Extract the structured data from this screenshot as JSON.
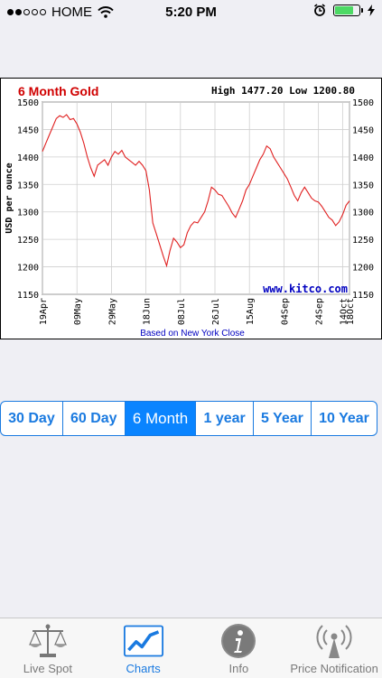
{
  "statusbar": {
    "carrier": "HOME",
    "time": "5:20 PM"
  },
  "chart_data": {
    "type": "line",
    "title": "6 Month Gold",
    "high_label": "High 1477.20 Low 1200.80",
    "ylabel": "USD per ounce",
    "xlabel": "Based on New York Close",
    "watermark": "www.kitco.com",
    "ylim": [
      1150,
      1500
    ],
    "yticks": [
      1150,
      1200,
      1250,
      1300,
      1350,
      1400,
      1450,
      1500
    ],
    "xticks": [
      "19Apr",
      "09May",
      "29May",
      "18Jun",
      "08Jul",
      "26Jul",
      "15Aug",
      "04Sep",
      "24Sep",
      "14Oct",
      "18Oct"
    ],
    "grid": true,
    "series": [
      {
        "color": "#e02020",
        "values": [
          1410,
          1425,
          1440,
          1455,
          1470,
          1475,
          1472,
          1477,
          1468,
          1470,
          1460,
          1445,
          1425,
          1400,
          1380,
          1365,
          1385,
          1390,
          1395,
          1385,
          1400,
          1410,
          1405,
          1412,
          1400,
          1395,
          1390,
          1385,
          1392,
          1385,
          1375,
          1340,
          1280,
          1260,
          1240,
          1220,
          1202,
          1230,
          1252,
          1245,
          1235,
          1240,
          1262,
          1275,
          1282,
          1280,
          1290,
          1300,
          1320,
          1345,
          1340,
          1332,
          1330,
          1320,
          1310,
          1298,
          1290,
          1305,
          1320,
          1340,
          1350,
          1365,
          1380,
          1395,
          1405,
          1420,
          1415,
          1400,
          1390,
          1380,
          1370,
          1360,
          1345,
          1330,
          1320,
          1335,
          1345,
          1335,
          1325,
          1320,
          1318,
          1310,
          1300,
          1290,
          1285,
          1275,
          1282,
          1295,
          1312,
          1320
        ]
      }
    ]
  },
  "segmented": {
    "options": [
      "30 Day",
      "60 Day",
      "6 Month",
      "1 year",
      "5 Year",
      "10 Year"
    ],
    "selected": "6 Month"
  },
  "tabbar": {
    "items": [
      {
        "label": "Live Spot",
        "icon": "scale-icon"
      },
      {
        "label": "Charts",
        "icon": "chart-icon"
      },
      {
        "label": "Info",
        "icon": "info-icon"
      },
      {
        "label": "Price Notification",
        "icon": "broadcast-tower-icon"
      }
    ],
    "active": "Charts"
  },
  "colors": {
    "accent": "#0a84ff",
    "line": "#e02020",
    "title": "#d00000",
    "link": "#0000c0"
  }
}
